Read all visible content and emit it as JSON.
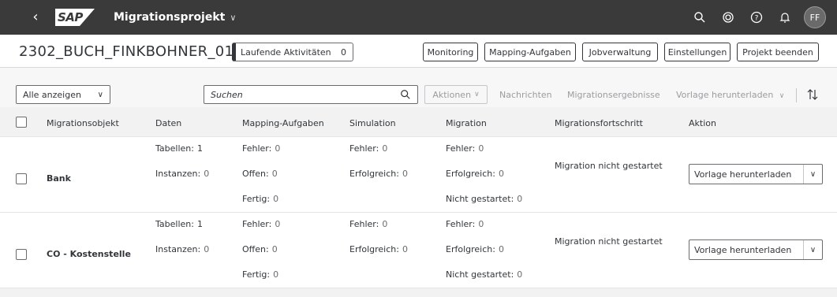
{
  "shell": {
    "logo": "SAP",
    "app_title": "Migrationsprojekt",
    "avatar_initials": "FF"
  },
  "header": {
    "project_title": "2302_BUCH_FINKBOHNER_01",
    "running_label": "Laufende Aktivitäten",
    "running_count": "0",
    "buttons": [
      "Monitoring",
      "Mapping-Aufgaben",
      "Jobverwaltung",
      "Einstellungen",
      "Projekt beenden"
    ]
  },
  "toolbar": {
    "filter_value": "Alle anzeigen",
    "search_placeholder": "Suchen",
    "aktionen_label": "Aktionen",
    "nachrichten_label": "Nachrichten",
    "ergebnisse_label": "Migrationsergebnisse",
    "vorlage_label": "Vorlage herunterladen"
  },
  "table": {
    "columns": [
      "Migrationsobjekt",
      "Daten",
      "Mapping-Aufgaben",
      "Simulation",
      "Migration",
      "Migrationsfortschritt",
      "Aktion"
    ],
    "rows": [
      {
        "name": "Bank",
        "tabellen_label": "Tabellen:",
        "tabellen": "1",
        "instanzen_label": "Instanzen:",
        "instanzen": "0",
        "map_fehler_label": "Fehler:",
        "map_fehler": "0",
        "map_offen_label": "Offen:",
        "map_offen": "0",
        "map_fertig_label": "Fertig:",
        "map_fertig": "0",
        "sim_fehler_label": "Fehler:",
        "sim_fehler": "0",
        "sim_erfolg_label": "Erfolgreich:",
        "sim_erfolg": "0",
        "mig_fehler_label": "Fehler:",
        "mig_fehler": "0",
        "mig_erfolg_label": "Erfolgreich:",
        "mig_erfolg": "0",
        "mig_nicht_label": "Nicht gestartet:",
        "mig_nicht": "0",
        "progress": "Migration nicht gestartet",
        "action": "Vorlage herunterladen"
      },
      {
        "name": "CO - Kostenstelle",
        "tabellen_label": "Tabellen:",
        "tabellen": "1",
        "instanzen_label": "Instanzen:",
        "instanzen": "0",
        "map_fehler_label": "Fehler:",
        "map_fehler": "0",
        "map_offen_label": "Offen:",
        "map_offen": "0",
        "map_fertig_label": "Fertig:",
        "map_fertig": "0",
        "sim_fehler_label": "Fehler:",
        "sim_fehler": "0",
        "sim_erfolg_label": "Erfolgreich:",
        "sim_erfolg": "0",
        "mig_fehler_label": "Fehler:",
        "mig_fehler": "0",
        "mig_erfolg_label": "Erfolgreich:",
        "mig_erfolg": "0",
        "mig_nicht_label": "Nicht gestartet:",
        "mig_nicht": "0",
        "progress": "Migration nicht gestartet",
        "action": "Vorlage herunterladen"
      }
    ]
  },
  "icons": [
    "back-icon",
    "chevron-down-icon",
    "search-icon",
    "sync-icon",
    "help-icon",
    "bell-icon",
    "sort-icon"
  ]
}
